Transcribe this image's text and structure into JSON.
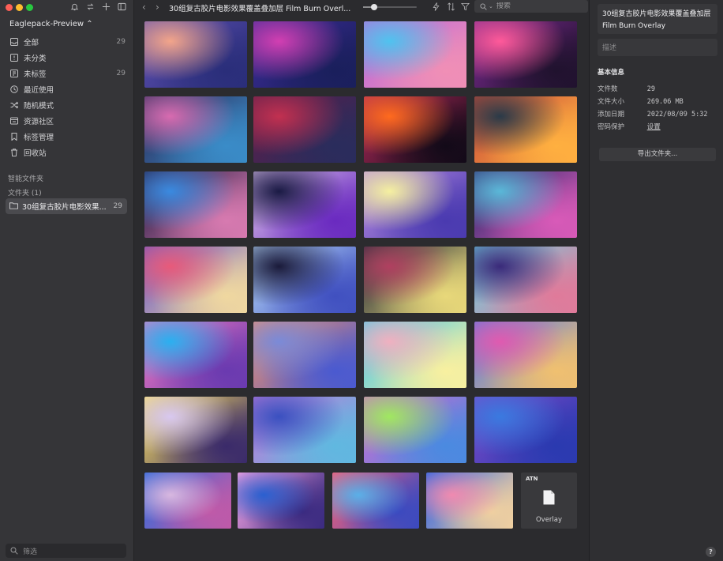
{
  "sidebar": {
    "library_name": "Eaglepack-Preview ⌃",
    "nav": [
      {
        "label": "全部",
        "count": "29",
        "icon": "inbox-icon"
      },
      {
        "label": "未分类",
        "count": "",
        "icon": "uncategorized-icon"
      },
      {
        "label": "未标签",
        "count": "29",
        "icon": "untagged-icon"
      },
      {
        "label": "最近使用",
        "count": "",
        "icon": "clock-icon"
      },
      {
        "label": "随机模式",
        "count": "",
        "icon": "shuffle-icon"
      },
      {
        "label": "资源社区",
        "count": "",
        "icon": "community-icon"
      },
      {
        "label": "标签管理",
        "count": "",
        "icon": "bookmark-icon"
      },
      {
        "label": "回收站",
        "count": "",
        "icon": "trash-icon"
      }
    ],
    "smart_folders_label": "智能文件夹",
    "folders_label": "文件夹 (1)",
    "folder": {
      "name": "30组复古胶片电影效果...",
      "count": "29"
    },
    "filter_placeholder": "筛选"
  },
  "toolbar": {
    "title": "30组复古胶片电影效果覆盖叠加层 Film Burn Overl...",
    "zoom_fraction": 0.2,
    "search_placeholder": "搜索"
  },
  "grid": {
    "items": [
      {
        "c": [
          "#f3a58a",
          "#5d4fb0",
          "#2a2e7a"
        ]
      },
      {
        "c": [
          "#d23fb2",
          "#3b2c96",
          "#1a1f5c"
        ]
      },
      {
        "c": [
          "#4fc3ef",
          "#b968d8",
          "#f08fb6"
        ]
      },
      {
        "c": [
          "#ff5a9a",
          "#7a2a8e",
          "#20122e"
        ]
      },
      {
        "c": [
          "#d86bb0",
          "#2c2a58",
          "#3a8cc8"
        ]
      },
      {
        "c": [
          "#c23050",
          "#5a1f4a",
          "#2a2c5c"
        ]
      },
      {
        "c": [
          "#ff6a1e",
          "#b02a5a",
          "#120a18"
        ]
      },
      {
        "c": [
          "#2a3a48",
          "#c84a3a",
          "#ffb040"
        ]
      },
      {
        "c": [
          "#3a8ae0",
          "#241c42",
          "#d77ab0"
        ]
      },
      {
        "c": [
          "#1a1a44",
          "#d8c0e8",
          "#6a2ac0"
        ]
      },
      {
        "c": [
          "#f5f0a0",
          "#b58ae0",
          "#4a3ab0"
        ]
      },
      {
        "c": [
          "#5ab8d8",
          "#2c2a6c",
          "#d85ab8"
        ]
      },
      {
        "c": [
          "#e85a7a",
          "#6a58c8",
          "#f0d8a0"
        ]
      },
      {
        "c": [
          "#1a1a3a",
          "#b6d8f8",
          "#4050c0"
        ]
      },
      {
        "c": [
          "#b04060",
          "#242a3a",
          "#e8d87a"
        ]
      },
      {
        "c": [
          "#3a2a7a",
          "#70d0e0",
          "#e07a9a"
        ]
      },
      {
        "c": [
          "#2ab0f0",
          "#f07ac0",
          "#6a3ab0"
        ]
      },
      {
        "c": [
          "#7a8ad8",
          "#f0906a",
          "#4a5ad0"
        ]
      },
      {
        "c": [
          "#f0b0c0",
          "#4ac8e8",
          "#f8f0a0"
        ]
      },
      {
        "c": [
          "#e05ab0",
          "#5a7ae0",
          "#f0c070"
        ]
      },
      {
        "c": [
          "#d8c8f0",
          "#f8e060",
          "#3a2a6a"
        ]
      },
      {
        "c": [
          "#3a50c0",
          "#c07ad8",
          "#60b8e0"
        ]
      },
      {
        "c": [
          "#a0e860",
          "#d06ad0",
          "#4a8ae0"
        ]
      },
      {
        "c": [
          "#3a7ae0",
          "#7a4ac8",
          "#2a3ab0"
        ]
      },
      {
        "c": [
          "#d8b8e0",
          "#3a6ad8",
          "#c05aa8"
        ]
      },
      {
        "c": [
          "#2a60d0",
          "#f0a0e0",
          "#3a2a80"
        ]
      },
      {
        "c": [
          "#5ab0e8",
          "#f0607a",
          "#3a4ac0"
        ]
      },
      {
        "c": [
          "#f08ab0",
          "#3a68e0",
          "#f0d0a0"
        ]
      }
    ],
    "file_card": {
      "tag": "ATN",
      "name": "Overlay"
    }
  },
  "inspector": {
    "title": "30组复古胶片电影效果覆盖叠加层 Film Burn Overlay",
    "description_placeholder": "描述",
    "section": "基本信息",
    "props": [
      {
        "k": "文件数",
        "v": "29"
      },
      {
        "k": "文件大小",
        "v": "269.06 MB"
      },
      {
        "k": "添加日期",
        "v": "2022/08/09 5:32"
      },
      {
        "k": "密码保护",
        "v": "设置"
      }
    ],
    "export_label": "导出文件夹...",
    "help": "?"
  }
}
